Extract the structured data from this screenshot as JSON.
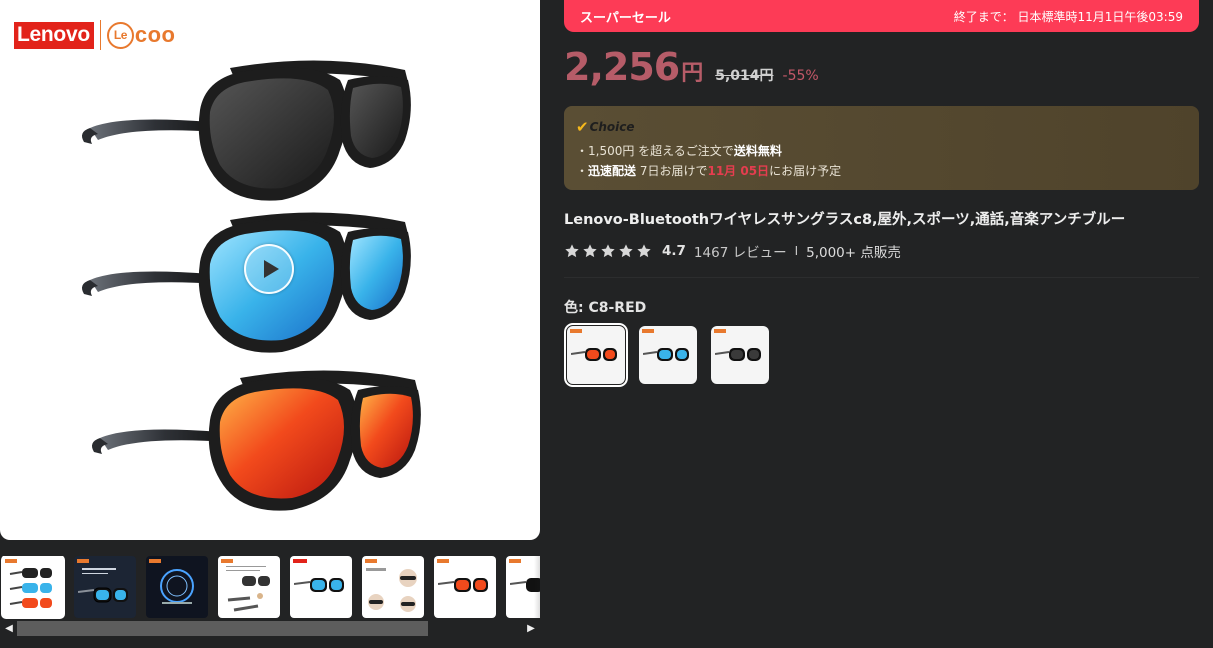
{
  "brand": {
    "lenovo": "Lenovo",
    "lecoo_le": "Le",
    "lecoo_coo": "coo"
  },
  "gallery": {
    "thumbnails": [
      {
        "name": "thumb-1-three-glasses"
      },
      {
        "name": "thumb-2-upgrade"
      },
      {
        "name": "thumb-3-bluetooth-chip"
      },
      {
        "name": "thumb-4-touch-function"
      },
      {
        "name": "thumb-5-blue-lens"
      },
      {
        "name": "thumb-6-show-results"
      },
      {
        "name": "thumb-7-red-lens"
      },
      {
        "name": "thumb-8-partial"
      }
    ],
    "lens_colors": {
      "black": "#2b2b2b",
      "blue": "#39b3ea",
      "red": "#f24a1c",
      "frame": "#1d1d1d"
    }
  },
  "sale": {
    "title": "スーパーセール",
    "countdown": "終了まで：  日本標準時11月1日午後03:59",
    "banner_color": "#fd3b56"
  },
  "price": {
    "current": "2,256",
    "unit": "円",
    "original": "5,014円",
    "discount": "-55%"
  },
  "choice": {
    "label": "Choice",
    "line1_prefix": "・1,500円 を超えるご注文で",
    "line1_bold": "送料無料",
    "line2_prefix": "・",
    "line2_bold": "迅速配送",
    "line2_mid": " 7日お届けで",
    "line2_date": "11月 05日",
    "line2_suffix": "にお届け予定"
  },
  "product": {
    "title": "Lenovo-Bluetoothワイヤレスサングラスc8,屋外,スポーツ,通話,音楽アンチブルー"
  },
  "rating": {
    "stars": 5,
    "value": "4.7",
    "reviews": "1467 レビュー",
    "separator": "I",
    "sold": "5,000+ 点販売"
  },
  "color": {
    "label": "色: C8-RED",
    "options": [
      {
        "name": "C8-RED",
        "lens": "#f24a1c",
        "selected": true
      },
      {
        "name": "C8-BLUE",
        "lens": "#39b3ea",
        "selected": false
      },
      {
        "name": "C8-BLACK",
        "lens": "#2b2b2b",
        "selected": false
      }
    ]
  },
  "icons": {
    "play": "play-icon",
    "star": "star-icon",
    "check": "check-icon",
    "scroll_left": "chevron-left-icon",
    "scroll_right": "chevron-right-icon"
  }
}
